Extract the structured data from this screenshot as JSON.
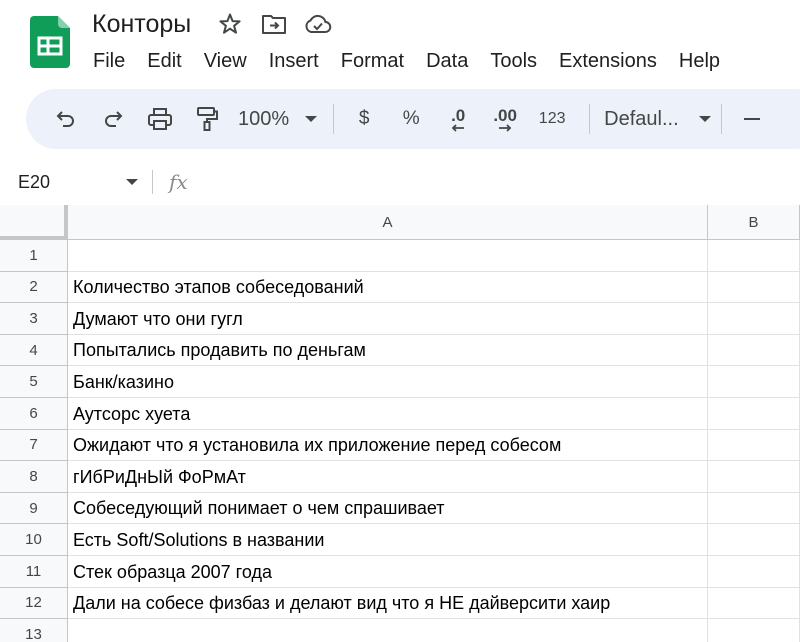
{
  "colors": {
    "logo_green": "#0f9d58",
    "toolbar_bg": "#edf2fa",
    "header_bg": "#f8f9fa",
    "grid_line": "#e1e1e1"
  },
  "doc": {
    "title": "Конторы",
    "icons": [
      "star-icon",
      "move-to-folder-icon",
      "cloud-saved-icon"
    ]
  },
  "menu": [
    "File",
    "Edit",
    "View",
    "Insert",
    "Format",
    "Data",
    "Tools",
    "Extensions",
    "Help"
  ],
  "toolbar": {
    "icons": [
      "undo-icon",
      "redo-icon",
      "print-icon",
      "paint-format-icon"
    ],
    "zoom": "100%",
    "currency": "$",
    "percent": "%",
    "decrease_decimal": ".0",
    "increase_decimal": ".00",
    "number_format": "123",
    "font": "Defaul..."
  },
  "formula_bar": {
    "cell_ref": "E20",
    "fx_label": "fx",
    "value": ""
  },
  "sheet": {
    "columns": [
      "A",
      "B"
    ],
    "rows": [
      {
        "num": "1",
        "a": ""
      },
      {
        "num": "2",
        "a": "Количество этапов собеседований"
      },
      {
        "num": "3",
        "a": "Думают что они гугл"
      },
      {
        "num": "4",
        "a": "Попытались продавить по деньгам"
      },
      {
        "num": "5",
        "a": "Банк/казино"
      },
      {
        "num": "6",
        "a": "Аутсорс хуета"
      },
      {
        "num": "7",
        "a": "Ожидают что я установила их приложение перед собесом"
      },
      {
        "num": "8",
        "a": "гИбРиДнЫй ФоРмАт"
      },
      {
        "num": "9",
        "a": "Собеседующий понимает о чем спрашивает"
      },
      {
        "num": "10",
        "a": "Есть Soft/Solutions в названии"
      },
      {
        "num": "11",
        "a": "Стек образца 2007 года"
      },
      {
        "num": "12",
        "a": "Дали на собесе физбаз и делают вид что я НЕ дайверсити хаир"
      },
      {
        "num": "13",
        "a": ""
      }
    ]
  }
}
